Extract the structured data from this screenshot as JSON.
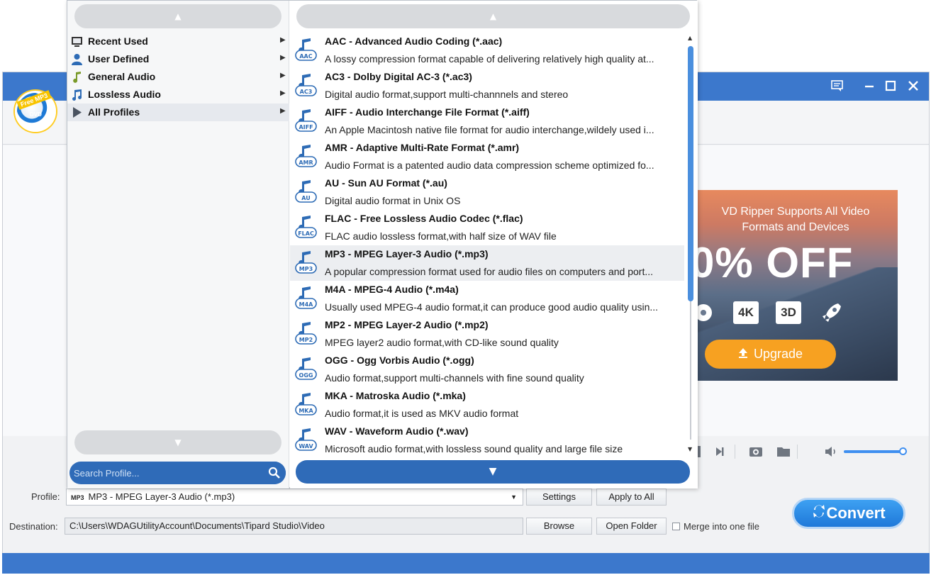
{
  "app": {
    "logo_tag": "Free MP3",
    "logo_sub": "DVD",
    "window_buttons": [
      "feedback-icon",
      "minimize-icon",
      "maximize-icon",
      "close-icon"
    ]
  },
  "ad": {
    "line1": "VD Ripper Supports All Video",
    "line2": "Formats and Devices",
    "offer": "0% OFF",
    "badge_4k": "4K",
    "badge_3d": "3D",
    "upgrade_label": "Upgrade"
  },
  "dropdown": {
    "categories": [
      {
        "label": "Recent Used",
        "icon": "monitor-icon"
      },
      {
        "label": "User Defined",
        "icon": "user-icon"
      },
      {
        "label": "General Audio",
        "icon": "music-note-icon"
      },
      {
        "label": "Lossless Audio",
        "icon": "music-notes-icon"
      },
      {
        "label": "All Profiles",
        "icon": "play-triangle-icon"
      }
    ],
    "search_placeholder": "Search Profile...",
    "formats": [
      {
        "icon_text": "AAC",
        "title": "AAC - Advanced Audio Coding (*.aac)",
        "desc": "A lossy compression format capable of delivering relatively high quality at..."
      },
      {
        "icon_text": "AC3",
        "title": "AC3 - Dolby Digital AC-3 (*.ac3)",
        "desc": "Digital audio format,support multi-channnels and stereo"
      },
      {
        "icon_text": "AIFF",
        "title": "AIFF - Audio Interchange File Format (*.aiff)",
        "desc": "An Apple Macintosh native file format for audio interchange,wildely used i..."
      },
      {
        "icon_text": "AMR",
        "title": "AMR - Adaptive Multi-Rate Format (*.amr)",
        "desc": "Audio Format is a patented audio data compression scheme optimized fo..."
      },
      {
        "icon_text": "AU",
        "title": "AU - Sun AU Format (*.au)",
        "desc": "Digital audio format in Unix OS"
      },
      {
        "icon_text": "FLAC",
        "title": "FLAC - Free Lossless Audio Codec (*.flac)",
        "desc": "FLAC audio lossless format,with half size of WAV file"
      },
      {
        "icon_text": "MP3",
        "title": "MP3 - MPEG Layer-3 Audio (*.mp3)",
        "desc": "A popular compression format used for audio files on computers and port..."
      },
      {
        "icon_text": "M4A",
        "title": "M4A - MPEG-4 Audio (*.m4a)",
        "desc": "Usually used MPEG-4 audio format,it can produce good audio quality usin..."
      },
      {
        "icon_text": "MP2",
        "title": "MP2 - MPEG Layer-2 Audio (*.mp2)",
        "desc": "MPEG layer2 audio format,with CD-like sound quality"
      },
      {
        "icon_text": "OGG",
        "title": "OGG - Ogg Vorbis Audio (*.ogg)",
        "desc": "Audio format,support multi-channels with fine sound quality"
      },
      {
        "icon_text": "MKA",
        "title": "MKA - Matroska Audio (*.mka)",
        "desc": "Audio format,it is used as MKV audio format"
      },
      {
        "icon_text": "WAV",
        "title": "WAV - Waveform Audio (*.wav)",
        "desc": "Microsoft audio format,with lossless sound quality and large file size"
      }
    ]
  },
  "bottom": {
    "profile_label": "Profile:",
    "profile_value": "MP3 - MPEG Layer-3 Audio (*.mp3)",
    "profile_icon_text": "MP3",
    "settings_label": "Settings",
    "apply_all_label": "Apply to All",
    "destination_label": "Destination:",
    "destination_value": "C:\\Users\\WDAGUtilityAccount\\Documents\\Tipard Studio\\Video",
    "browse_label": "Browse",
    "open_folder_label": "Open Folder",
    "merge_label": "Merge into one file",
    "convert_label": "Convert"
  },
  "colors": {
    "accent_blue": "#3c78cc",
    "dark_blue": "#2f6bb8",
    "upgrade_orange": "#f7a121",
    "scroll_thumb": "#4a8fde"
  }
}
